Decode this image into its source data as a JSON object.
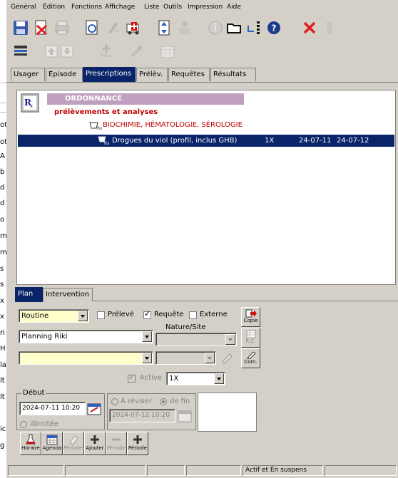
{
  "menu": [
    "Général",
    "Édition",
    "Fonctions",
    "Affichage",
    "Liste",
    "Outils",
    "Impression",
    "Aide"
  ],
  "toolbar": {
    "row1": [
      {
        "name": "save-icon",
        "enabled": true
      },
      {
        "name": "delete-document-icon",
        "enabled": true
      },
      {
        "name": "print-icon",
        "enabled": false
      },
      {
        "name": "refresh-document-icon",
        "enabled": true
      },
      {
        "name": "antibiotic-icon",
        "enabled": false
      },
      {
        "name": "ambulance-icon",
        "enabled": true
      },
      {
        "name": "resize-vertical-icon",
        "enabled": true
      },
      {
        "name": "users-icon",
        "enabled": false
      },
      {
        "name": "info-icon",
        "enabled": false
      },
      {
        "name": "folder-icon",
        "enabled": true
      },
      {
        "name": "sort-icon",
        "enabled": true
      },
      {
        "name": "help-icon",
        "enabled": true
      },
      {
        "name": "close-icon",
        "enabled": true
      },
      {
        "name": "traffic-light-icon",
        "enabled": false
      }
    ],
    "row2": [
      {
        "name": "list-icon",
        "enabled": true
      },
      {
        "name": "up-arrow-icon",
        "enabled": false
      },
      {
        "name": "down-arrow-icon",
        "enabled": false
      },
      {
        "name": "add-presc-icon",
        "enabled": false,
        "label": "Presc."
      },
      {
        "name": "add-syringe-icon",
        "enabled": false
      },
      {
        "name": "add-grid-icon",
        "enabled": false
      }
    ]
  },
  "tabs": [
    "Usager",
    "Épisode",
    "Prescriptions",
    "Prélèv.",
    "Requêtes",
    "Résultats"
  ],
  "active_tab": 2,
  "tree": {
    "header": "ORDONNANCE",
    "subheader": "prélèvements et analyses",
    "category": "BIOCHIMIE, HÉMATOLOGIE, SÉROLOGIE",
    "item": {
      "name": "Drogues du viol (profil, inclus GHB)",
      "freq": "1X",
      "start": "24-07-11",
      "end": "24-07-12"
    }
  },
  "subtabs": [
    "Plan",
    "Intervention"
  ],
  "form": {
    "priority": "Routine",
    "preleve_label": "Prélevé",
    "requete_label": "Requête",
    "externe_label": "Externe",
    "copie_label": "Copie",
    "nature_label": "Nature/Site",
    "planning": "Planning Riki",
    "rc_label": "R.C.",
    "com_label": "Com.",
    "active_label": "Active",
    "frequency": "1X",
    "debut_label": "Début",
    "debut_value": "2024-07-11 10:20",
    "illimitee_label": "illimitée",
    "a_reviser_label": "À réviser",
    "de_fin_label": "de fin",
    "fin_value": "2024-07-12 10:20"
  },
  "bottom_buttons": [
    {
      "label": "Horaire",
      "icon": "flask-icon",
      "enabled": true
    },
    {
      "label": "Agenda",
      "icon": "calendar-icon",
      "enabled": true
    },
    {
      "label": "Périodes",
      "icon": "eraser-icon",
      "enabled": false
    },
    {
      "label": "Ajouter",
      "icon": "plus-icon",
      "enabled": true
    },
    {
      "label": "Période",
      "icon": "minus-icon",
      "enabled": false
    },
    {
      "label": "Période",
      "icon": "plus-icon",
      "enabled": true
    }
  ],
  "status": {
    "text": "Actif et En suspens"
  },
  "left_fragments": [
    "ot",
    "ot",
    "A",
    "b",
    "d",
    "d",
    "o",
    "m",
    "m",
    "s",
    "s",
    "x",
    "x",
    "ri",
    "H",
    "la",
    "lt",
    "lt",
    "ic",
    "g"
  ],
  "colors": {
    "header_bar": "#c0a0c0",
    "subheader_text": "#c00000",
    "selection": "#0a246a",
    "field_yellow": "#ffffcc"
  }
}
